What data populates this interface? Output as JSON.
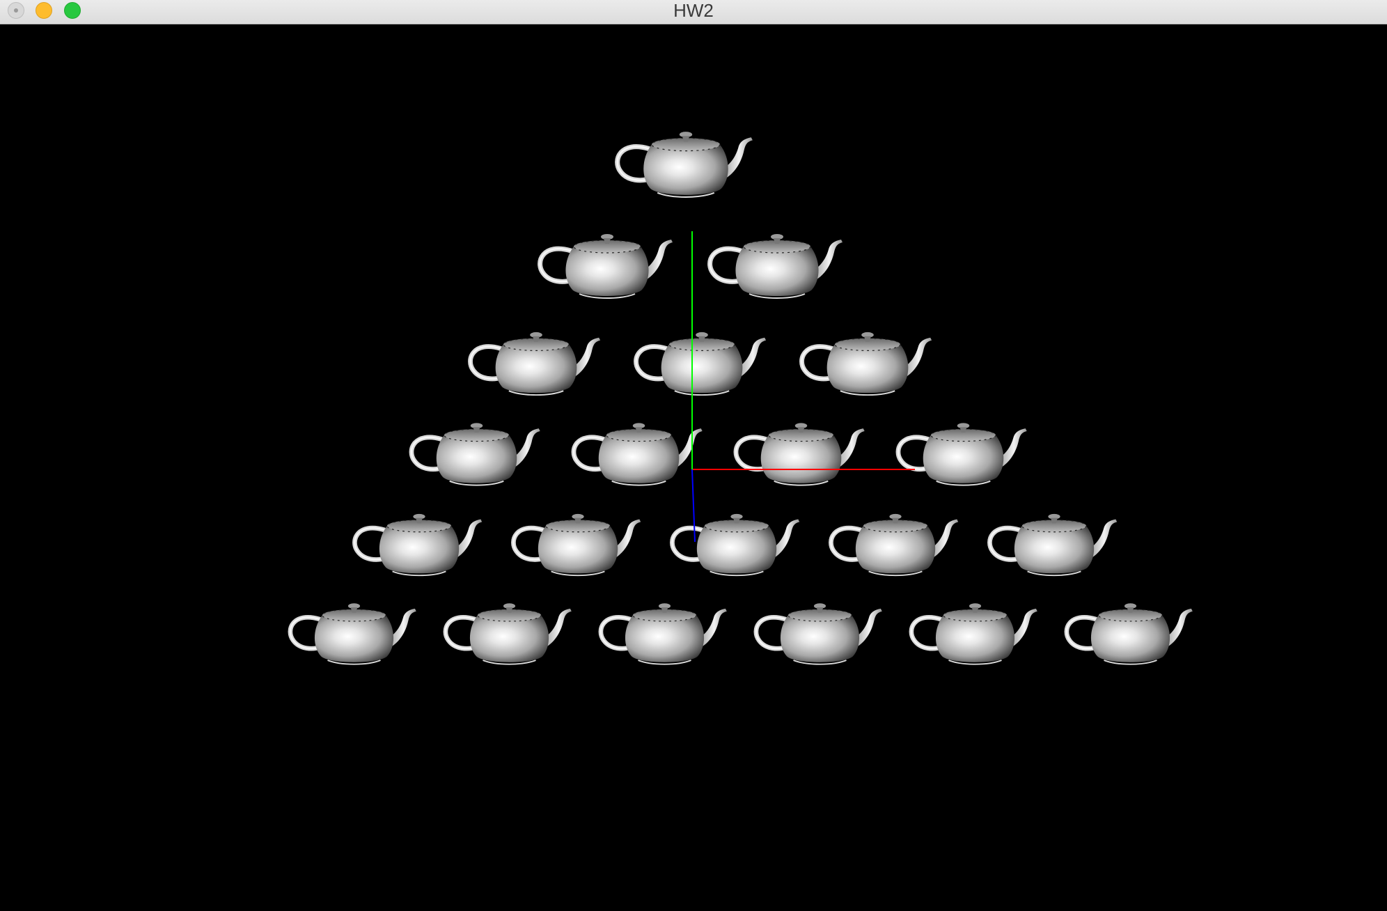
{
  "window": {
    "title": "HW2",
    "background": "#000000"
  },
  "titlebar_buttons": [
    {
      "name": "close",
      "color": "#d8d8d8"
    },
    {
      "name": "minimize",
      "color": "#fdbc2e"
    },
    {
      "name": "zoom",
      "color": "#28c840"
    }
  ],
  "scene": {
    "object": "teapot",
    "arrangement": "pyramid",
    "rows": [
      1,
      2,
      3,
      4,
      5,
      6
    ],
    "axes": {
      "x_color": "#ff0000",
      "y_color": "#00ff00",
      "z_color": "#0000ff"
    },
    "teapot_colors": {
      "highlight": "#ffffff",
      "mid": "#b4b4b4",
      "shadow": "#3c3c3c"
    }
  }
}
